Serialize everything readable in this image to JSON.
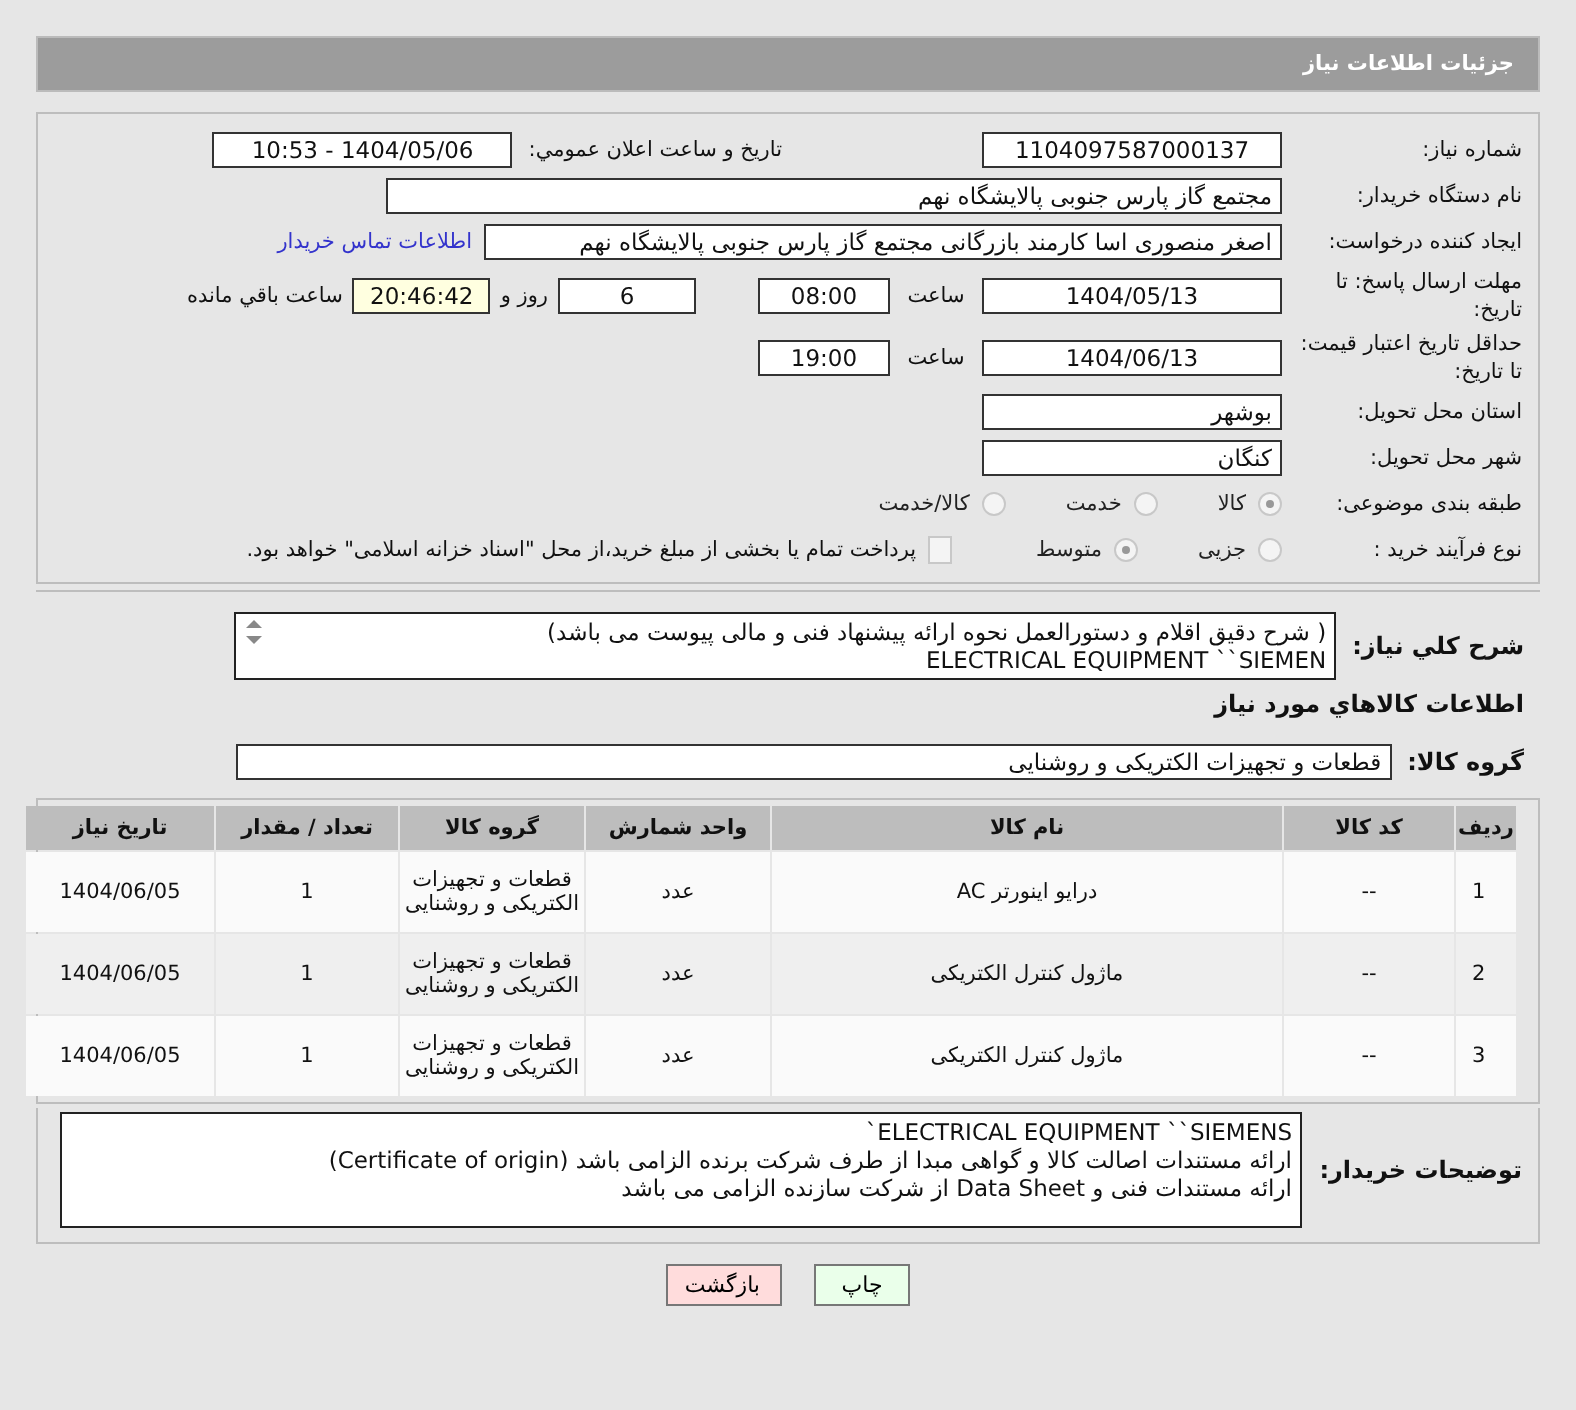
{
  "header": {
    "title": "جزئیات اطلاعات نیاز"
  },
  "need_number": {
    "label": "شماره نیاز:",
    "value": "1104097587000137"
  },
  "announce": {
    "label": "تاریخ و ساعت اعلان عمومي:",
    "value": "1404/05/06 - 10:53"
  },
  "buyer_org": {
    "label": "نام دستگاه خریدار:",
    "value": "مجتمع گاز پارس جنوبی  پالایشگاه نهم"
  },
  "requester": {
    "label": "ایجاد کننده درخواست:",
    "value": "اصغر منصوری اسا کارمند بازرگانی مجتمع گاز پارس جنوبی  پالایشگاه نهم",
    "link": "اطلاعات تماس خریدار"
  },
  "deadline": {
    "label": "مهلت ارسال پاسخ: تا تاریخ:",
    "date": "1404/05/13",
    "time_label": "ساعت",
    "time": "08:00",
    "days": "6",
    "days_label": "روز و",
    "remaining": "20:46:42",
    "remaining_label": "ساعت باقي مانده"
  },
  "validity": {
    "label": "حداقل تاریخ اعتبار قیمت: تا تاریخ:",
    "date": "1404/06/13",
    "time_label": "ساعت",
    "time": "19:00"
  },
  "province": {
    "label": "استان محل تحویل:",
    "value": "بوشهر"
  },
  "city": {
    "label": "شهر محل تحویل:",
    "value": "کنگان"
  },
  "category": {
    "label": "طبقه بندی موضوعی:",
    "options": [
      {
        "label": "كالا",
        "selected": true
      },
      {
        "label": "خدمت",
        "selected": false
      },
      {
        "label": "کالا/خدمت",
        "selected": false
      }
    ]
  },
  "purchase_type": {
    "label": "نوع فرآیند خرید :",
    "options": [
      {
        "label": "جزیی",
        "selected": false
      },
      {
        "label": "متوسط",
        "selected": true
      }
    ],
    "payment": {
      "checked": false,
      "text": "پرداخت تمام یا بخشی از مبلغ خرید،از محل \"اسناد خزانه اسلامی\" خواهد بود."
    }
  },
  "description": {
    "label": "شرح کلي نیاز:",
    "lines": [
      "( شرح دقیق اقلام و دستورالعمل نحوه ارائه پیشنهاد فنی و مالی پیوست می باشد)",
      "ELECTRICAL EQUIPMENT ``SIEMEN"
    ]
  },
  "goods": {
    "title": "اطلاعات كالاهاي مورد نياز",
    "group_label": "گروه کالا:",
    "group_value": "قطعات و تجهیزات الکتریکی و روشنایی",
    "table": {
      "columns": [
        "ردیف",
        "کد کالا",
        "نام کالا",
        "واحد شمارش",
        "گروه کالا",
        "تعداد / مقدار",
        "تاریخ نیاز"
      ],
      "rows": [
        [
          "1",
          "--",
          "درایو اینورتر AC",
          "عدد",
          "قطعات و تجهیزات الکتریکی و روشنایی",
          "1",
          "1404/06/05"
        ],
        [
          "2",
          "--",
          "ماژول کنترل الکتریکی",
          "عدد",
          "قطعات و تجهیزات الکتریکی و روشنایی",
          "1",
          "1404/06/05"
        ],
        [
          "3",
          "--",
          "ماژول کنترل الکتریکی",
          "عدد",
          "قطعات و تجهیزات الکتریکی و روشنایی",
          "1",
          "1404/06/05"
        ]
      ]
    }
  },
  "notes": {
    "label": "توضیحات خریدار:",
    "lines": [
      "ELECTRICAL EQUIPMENT ``SIEMENS`",
      "ارائه مستندات اصالت کالا و گواهی مبدا از طرف شرکت برنده الزامی باشد (Certificate of origin)",
      "ارائه مستندات فنی و Data Sheet از شرکت سازنده الزامی می باشد"
    ]
  },
  "buttons": [
    {
      "label": "چاپ",
      "kind": "print"
    },
    {
      "label": "بازگشت",
      "kind": "back"
    }
  ]
}
